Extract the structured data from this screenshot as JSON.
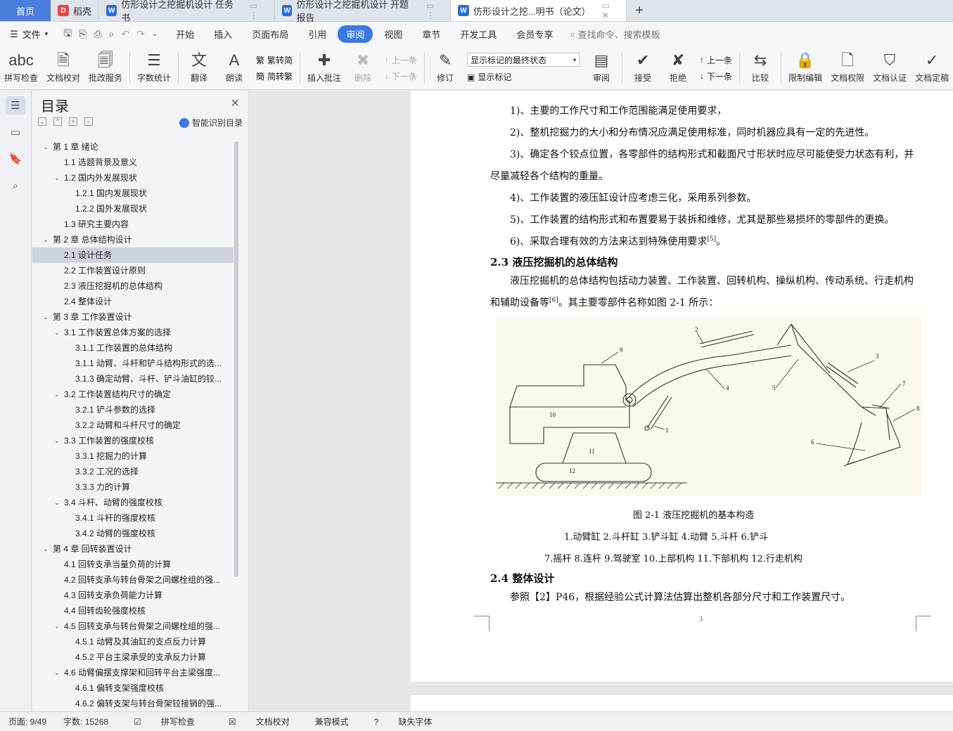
{
  "tabs": {
    "home": "首页",
    "daoke": "稻壳",
    "doc1": "仿形设计之挖掘机设计 任务书",
    "doc2": "仿形设计之挖掘机设计 开题报告",
    "doc3": "仿形设计之挖...明书（论文）"
  },
  "menu": {
    "file": "文件",
    "items": [
      "开始",
      "插入",
      "页面布局",
      "引用",
      "审阅",
      "视图",
      "章节",
      "开发工具",
      "会员专享"
    ],
    "active": "审阅",
    "search": "查找命令、搜索模板"
  },
  "ribbon": {
    "spellcheck": "拼写检查",
    "doc_check": "文档校对",
    "batch_service": "批改服务",
    "word_count": "字数统计",
    "translate": "翻译",
    "read_aloud": "朗读",
    "trad_simp": "繁转简",
    "simp_trad": "简转繁",
    "insert_comment": "插入批注",
    "delete": "删除",
    "prev_item": "上一条",
    "next_item": "下一条",
    "revise": "修订",
    "markup_state": "显示标记的最终状态",
    "show_markup": "显示标记",
    "review": "审阅",
    "accept": "接受",
    "reject": "拒绝",
    "prev": "上一条",
    "next": "下一条",
    "compare": "比较",
    "restrict_edit": "限制编辑",
    "doc_permission": "文档权限",
    "doc_cert": "文档认证",
    "doc_final": "文档定稿"
  },
  "toc": {
    "title": "目录",
    "smart": "智能识别目录",
    "items": [
      {
        "level": 1,
        "caret": "v",
        "text": "第 1 章  绪论"
      },
      {
        "level": 2,
        "caret": "",
        "text": "1.1 选题背景及意义"
      },
      {
        "level": 2,
        "caret": "v",
        "text": "1.2 国内外发展现状"
      },
      {
        "level": 3,
        "caret": "",
        "text": "1.2.1 国内发展现状"
      },
      {
        "level": 3,
        "caret": "",
        "text": "1.2.2 国外发展现状"
      },
      {
        "level": 2,
        "caret": "",
        "text": "1.3 研究主要内容"
      },
      {
        "level": 1,
        "caret": "v",
        "text": "第 2 章  总体结构设计"
      },
      {
        "level": 2,
        "caret": "",
        "text": "2.1 设计任务",
        "selected": true
      },
      {
        "level": 2,
        "caret": "",
        "text": "2.2 工作装置设计原则"
      },
      {
        "level": 2,
        "caret": "",
        "text": "2.3 液压挖掘机的总体结构"
      },
      {
        "level": 2,
        "caret": "",
        "text": "2.4 整体设计"
      },
      {
        "level": 1,
        "caret": "v",
        "text": "第 3 章  工作装置设计"
      },
      {
        "level": 2,
        "caret": "v",
        "text": "3.1  工作装置总体方案的选择"
      },
      {
        "level": 3,
        "caret": "",
        "text": "3.1.1 工作装置的总体结构"
      },
      {
        "level": 3,
        "caret": "",
        "text": "3.1.1 动臂、斗杆和铲斗结构形式的选..."
      },
      {
        "level": 3,
        "caret": "",
        "text": "3.1.3 确定动臂、斗杆、铲斗油缸的铰..."
      },
      {
        "level": 2,
        "caret": "v",
        "text": "3.2 工作装置结构尺寸的确定"
      },
      {
        "level": 3,
        "caret": "",
        "text": "3.2.1 铲斗参数的选择"
      },
      {
        "level": 3,
        "caret": "",
        "text": "3.2.2 动臂和斗杆尺寸的确定"
      },
      {
        "level": 2,
        "caret": "v",
        "text": "3.3 工作装置的强度校核"
      },
      {
        "level": 3,
        "caret": "",
        "text": "3.3.1 挖掘力的计算"
      },
      {
        "level": 3,
        "caret": "",
        "text": "3.3.2 工况的选择"
      },
      {
        "level": 3,
        "caret": "",
        "text": "3.3.3 力的计算"
      },
      {
        "level": 2,
        "caret": "v",
        "text": "3.4 斗杆、动臂的强度校核"
      },
      {
        "level": 3,
        "caret": "",
        "text": "3.4.1 斗杆的强度校核"
      },
      {
        "level": 3,
        "caret": "",
        "text": "3.4.2 动臂的强度校核"
      },
      {
        "level": 1,
        "caret": "v",
        "text": "第 4 章  回转装置设计"
      },
      {
        "level": 2,
        "caret": "",
        "text": "4.1 回转支承当量负荷的计算"
      },
      {
        "level": 2,
        "caret": "",
        "text": "4.2 回转支承与转台骨架之间螺栓组的强..."
      },
      {
        "level": 2,
        "caret": "",
        "text": "4.3 回转支承负荷能力计算"
      },
      {
        "level": 2,
        "caret": "",
        "text": "4.4 回转齿轮强度校核"
      },
      {
        "level": 2,
        "caret": "v",
        "text": "4.5  回转支承与转台骨架之间螺栓组的强..."
      },
      {
        "level": 3,
        "caret": "",
        "text": "4.5.1  动臂及其油缸的支点反力计算"
      },
      {
        "level": 3,
        "caret": "",
        "text": "4.5.2  平台主梁承受的支承反力计算"
      },
      {
        "level": 2,
        "caret": "v",
        "text": "4.6 动臂偏摆支撑架和回转平台主梁强度..."
      },
      {
        "level": 3,
        "caret": "",
        "text": "4.6.1  偏转支架强度校核"
      },
      {
        "level": 3,
        "caret": "",
        "text": "4.6.2  偏转支架与转台骨架铰接销的强..."
      }
    ]
  },
  "doc": {
    "lines": [
      "1)、主要的工作尺寸和工作范围能满足使用要求，",
      "2)、整机挖掘力的大小和分布情况应满足使用标准，同时机器应具有一定的先进性。",
      "3)、确定各个铰点位置，各零部件的结构形式和截面尺寸形状时应尽可能使受力状态有利，并",
      "尽量减轻各个结构的重量。",
      "4)、工作装置的液压缸设计应考虑三化，采用系列参数。",
      "5)、工作装置的结构形式和布置要易于装拆和维修，尤其是那些易损坏的零部件的更换。",
      "6)、采取合理有效的方法来达到特殊使用要求"
    ],
    "ref5": "[5]",
    "period": "。",
    "h23": "2.3 液压挖掘机的总体结构",
    "p23a": "液压挖掘机的总体结构包括动力装置、工作装置、回转机构、操纵机构、传动系统、行走机构",
    "p23b": "和辅助设备等",
    "ref6": "[6]",
    "p23c": "。其主要零部件名称如图 2-1 所示：",
    "fig_labels": [
      "1",
      "2",
      "3",
      "4",
      "5",
      "6",
      "7",
      "8",
      "9",
      "10",
      "11",
      "12"
    ],
    "caption": "图 2-1 液压挖掘机的基本构造",
    "legend1": "1.动臂缸   2.斗杆缸   3.铲斗缸   4.动臂   5.斗杆   6.铲斗",
    "legend2": "7.摇杆   8.连杆   9.驾驶室   10.上部机构   11.下部机构   12.行走机构",
    "h24": "2.4 整体设计",
    "p24": "参照【2】P46，根据经验公式计算法估算出整机各部分尺寸和工作装置尺寸。",
    "page_number": "3"
  },
  "status": {
    "page": "页面: 9/49",
    "words": "字数: 15268",
    "spell": "拼写检查",
    "check": "文档校对",
    "compat": "兼容模式",
    "missing_font": "缺失字体"
  }
}
